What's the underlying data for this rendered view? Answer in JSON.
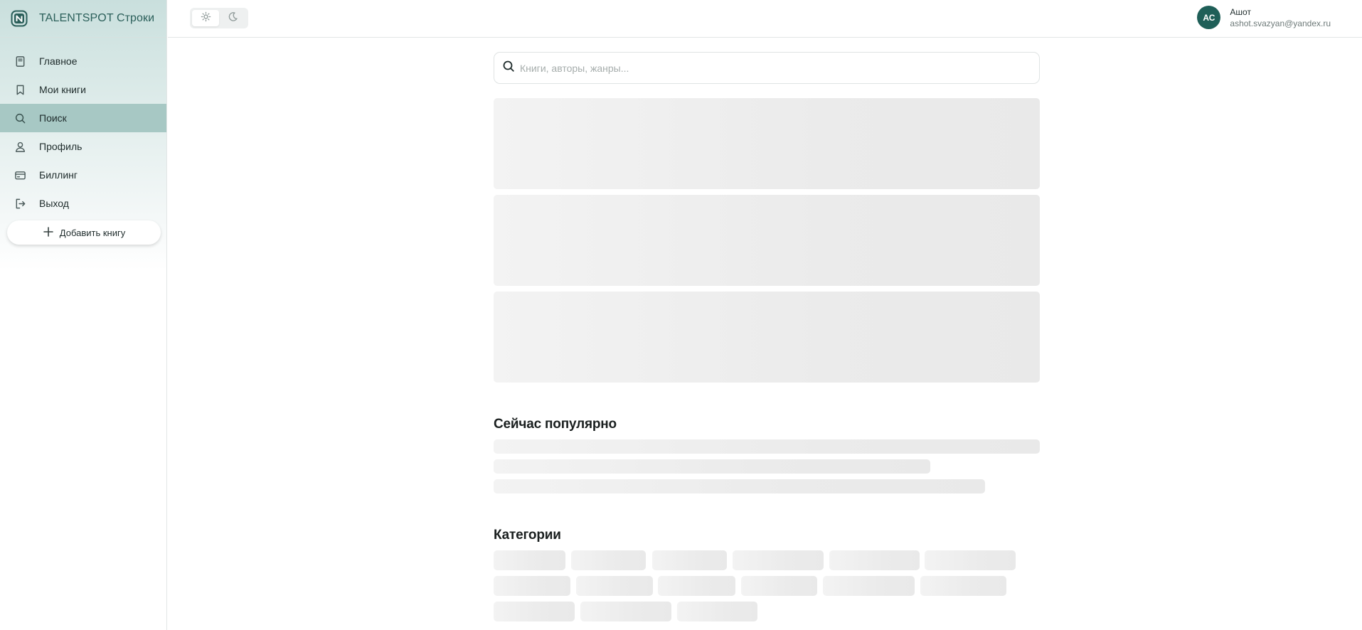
{
  "brand": {
    "name": "TALENTSPOT Строки"
  },
  "sidebar": {
    "items": [
      {
        "label": "Главное",
        "icon": "book-icon",
        "active": false
      },
      {
        "label": "Мои книги",
        "icon": "bookmark-icon",
        "active": false
      },
      {
        "label": "Поиск",
        "icon": "search-icon",
        "active": true
      },
      {
        "label": "Профиль",
        "icon": "user-icon",
        "active": false
      },
      {
        "label": "Биллинг",
        "icon": "credit-card-icon",
        "active": false
      },
      {
        "label": "Выход",
        "icon": "logout-icon",
        "active": false
      }
    ],
    "add_button": "Добавить книгу"
  },
  "header": {
    "theme": {
      "selected": "light"
    },
    "user": {
      "initials": "АС",
      "name": "Ашот",
      "email": "ashot.svazyan@yandex.ru"
    }
  },
  "search": {
    "placeholder": "Книги, авторы, жанры..."
  },
  "sections": {
    "popular_title": "Сейчас популярно",
    "categories_title": "Категории"
  },
  "colors": {
    "accent": "#1f5f58",
    "active_nav": "#a7c8c4",
    "brand_text": "#2b5f5a"
  }
}
